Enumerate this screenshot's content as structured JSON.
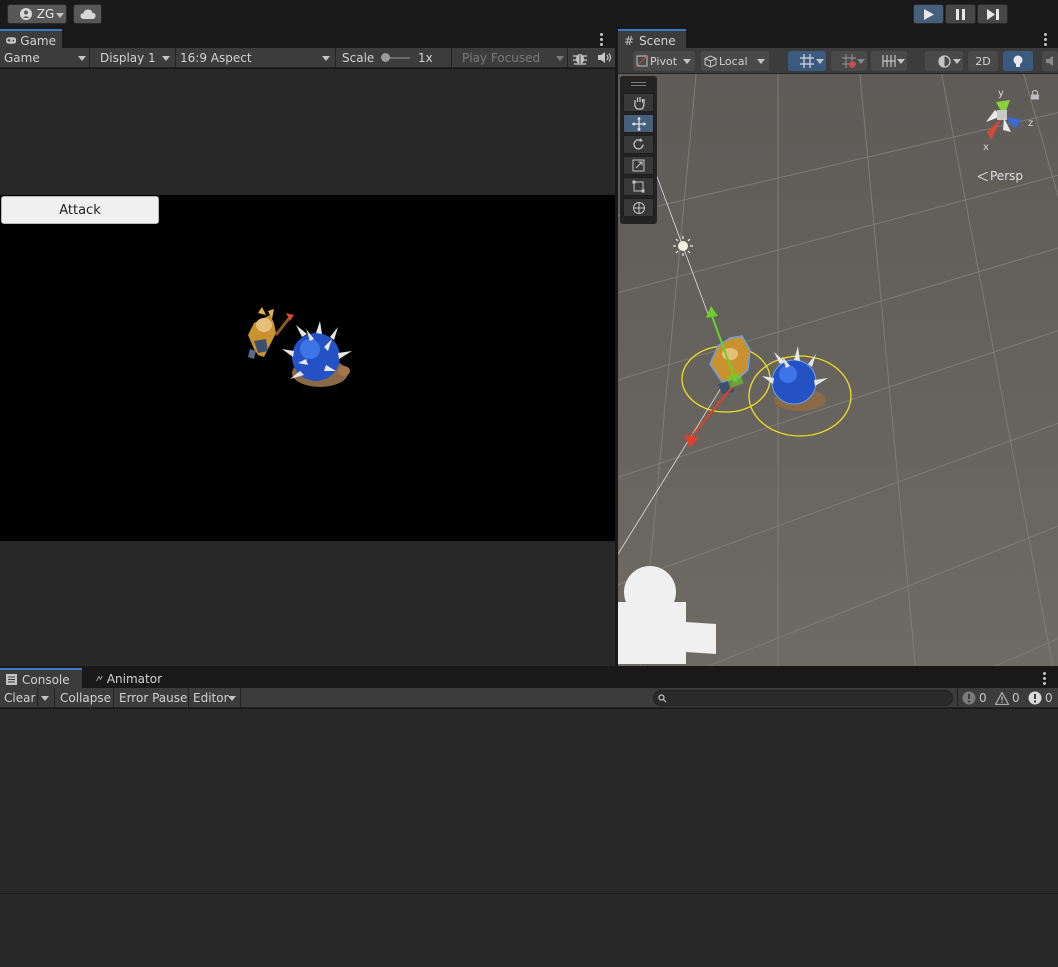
{
  "topbar": {
    "account_label": "ZG",
    "icons": [
      "account-icon",
      "cloud-icon",
      "play-icon",
      "pause-icon",
      "step-icon"
    ]
  },
  "game": {
    "tab_label": "Game",
    "mode_label": "Game",
    "display_label": "Display 1",
    "aspect_label": "16:9 Aspect",
    "scale_label": "Scale",
    "scale_value": "1x",
    "play_focused_label": "Play Focused",
    "attack_button_label": "Attack"
  },
  "scene": {
    "tab_label": "Scene",
    "pivot_label": "Pivot",
    "local_label": "Local",
    "mode_2d_label": "2D",
    "persp_label": "Persp",
    "gizmo_axes": {
      "y": "y",
      "z": "z",
      "x": "x"
    },
    "tools": [
      "hand-icon",
      "move-icon",
      "rotate-icon",
      "scale-icon",
      "rect-icon",
      "transform-icon"
    ]
  },
  "console": {
    "tab_label": "Console",
    "animator_tab_label": "Animator",
    "clear_label": "Clear",
    "collapse_label": "Collapse",
    "error_pause_label": "Error Pause",
    "editor_label": "Editor",
    "search_placeholder": "",
    "info_count": "0",
    "warning_count": "0",
    "error_count": "0"
  },
  "colors": {
    "play_active": "#2d4e72",
    "panel_bg": "#282828",
    "toolbar_bg": "#3c3c3c",
    "accent": "#3a79bb",
    "scene_ground": "#6e6a64"
  }
}
